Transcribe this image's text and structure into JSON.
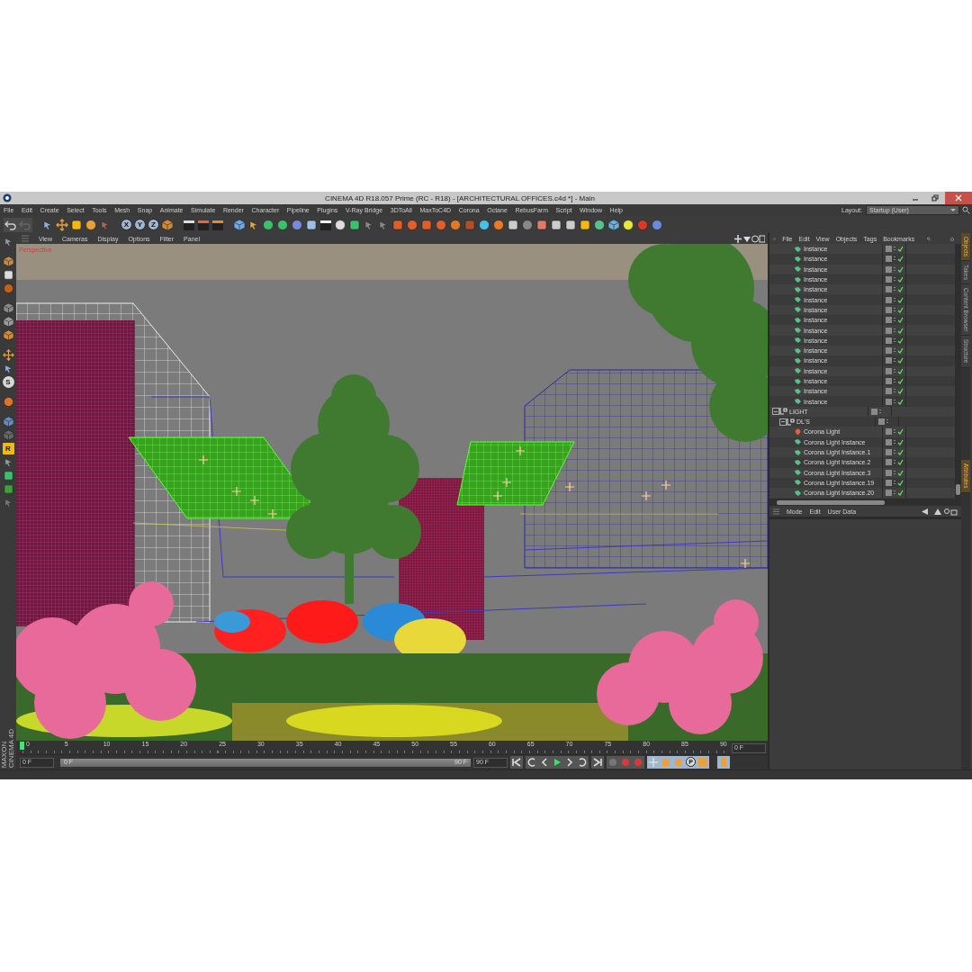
{
  "window": {
    "title": "CINEMA 4D R18.057 Prime (RC - R18) - [ARCHITECTURAL OFFICES.c4d *] - Main"
  },
  "menu": [
    "File",
    "Edit",
    "Create",
    "Select",
    "Tools",
    "Mesh",
    "Snap",
    "Animate",
    "Simulate",
    "Render",
    "Character",
    "Pipeline",
    "Plugins",
    "V-Ray Bridge",
    "3DToAll",
    "MaxToC4D",
    "Corona",
    "Octane",
    "RebusFarm",
    "Script",
    "Window",
    "Help"
  ],
  "layout": {
    "label": "Layout:",
    "value": "Startup (User)"
  },
  "toolbar": {
    "axis_buttons": [
      "X",
      "Y",
      "Z"
    ]
  },
  "left_toolbar": {
    "letter_buttons": [
      "S",
      "R"
    ]
  },
  "viewport": {
    "menu": [
      "View",
      "Cameras",
      "Display",
      "Options",
      "Filter",
      "Panel"
    ],
    "camera": "Perspective"
  },
  "timeline": {
    "ticks": [
      "0",
      "5",
      "10",
      "15",
      "20",
      "25",
      "30",
      "35",
      "40",
      "45",
      "50",
      "55",
      "60",
      "65",
      "70",
      "75",
      "80",
      "85",
      "90"
    ],
    "playhead": {
      "level": 0
    },
    "range_slider": {
      "level": 1
    },
    "brand": [
      "MAXON",
      "CINEMA 4D"
    ],
    "current_frame": "0 F",
    "start_field": "0 F",
    "range_start": "0 F",
    "range_end": "90 F",
    "end_field": "90 F",
    "key_button": "P"
  },
  "object_manager": {
    "menu": [
      "File",
      "Edit",
      "View",
      "Objects",
      "Tags",
      "Bookmarks"
    ],
    "continued_rows": [
      {
        "name": "Instance",
        "kind": "instance",
        "checked": true
      },
      {
        "name": "Instance",
        "kind": "instance",
        "checked": true
      },
      {
        "name": "Instance",
        "kind": "instance",
        "checked": true
      },
      {
        "name": "Instance",
        "kind": "instance",
        "checked": true
      },
      {
        "name": "Instance",
        "kind": "instance",
        "checked": true
      },
      {
        "name": "Instance",
        "kind": "instance",
        "checked": true
      },
      {
        "name": "Instance",
        "kind": "instance",
        "checked": true
      },
      {
        "name": "Instance",
        "kind": "instance",
        "checked": true
      },
      {
        "name": "Instance",
        "kind": "instance",
        "checked": true
      },
      {
        "name": "Instance",
        "kind": "instance",
        "checked": true
      },
      {
        "name": "Instance",
        "kind": "instance",
        "checked": true
      },
      {
        "name": "Instance",
        "kind": "instance",
        "checked": true
      },
      {
        "name": "Instance",
        "kind": "instance",
        "checked": true
      },
      {
        "name": "Instance",
        "kind": "instance",
        "checked": true
      },
      {
        "name": "Instance",
        "kind": "instance",
        "checked": true
      },
      {
        "name": "Instance",
        "kind": "instance",
        "checked": true
      }
    ],
    "objects": [
      {
        "name": "LIGHT",
        "kind": "null",
        "checked": false,
        "expanded": true,
        "children": [
          {
            "name": "DL'S",
            "kind": "null",
            "checked": false,
            "expanded": true,
            "children": [
              {
                "name": "Corona Light",
                "kind": "light",
                "checked": true
              },
              {
                "name": "Corona Light Instance",
                "kind": "instance",
                "checked": true
              },
              {
                "name": "Corona Light Instance.1",
                "kind": "instance",
                "checked": true
              },
              {
                "name": "Corona Light Instance.2",
                "kind": "instance",
                "checked": true
              },
              {
                "name": "Corona Light Instance.3",
                "kind": "instance",
                "checked": true
              },
              {
                "name": "Corona Light Instance.19",
                "kind": "instance",
                "checked": true
              },
              {
                "name": "Corona Light Instance.20",
                "kind": "instance",
                "checked": true
              }
            ]
          }
        ]
      }
    ]
  },
  "attributes": {
    "menu": [
      "Mode",
      "Edit",
      "User Data"
    ]
  },
  "side_tabs": [
    {
      "label": "Objects",
      "selected": true
    },
    {
      "label": "Takes",
      "selected": false
    },
    {
      "label": "Content Browser",
      "selected": false
    },
    {
      "label": "Structure",
      "selected": false
    }
  ],
  "lower_side_tabs": [
    {
      "label": "Attributes",
      "selected": true
    }
  ]
}
